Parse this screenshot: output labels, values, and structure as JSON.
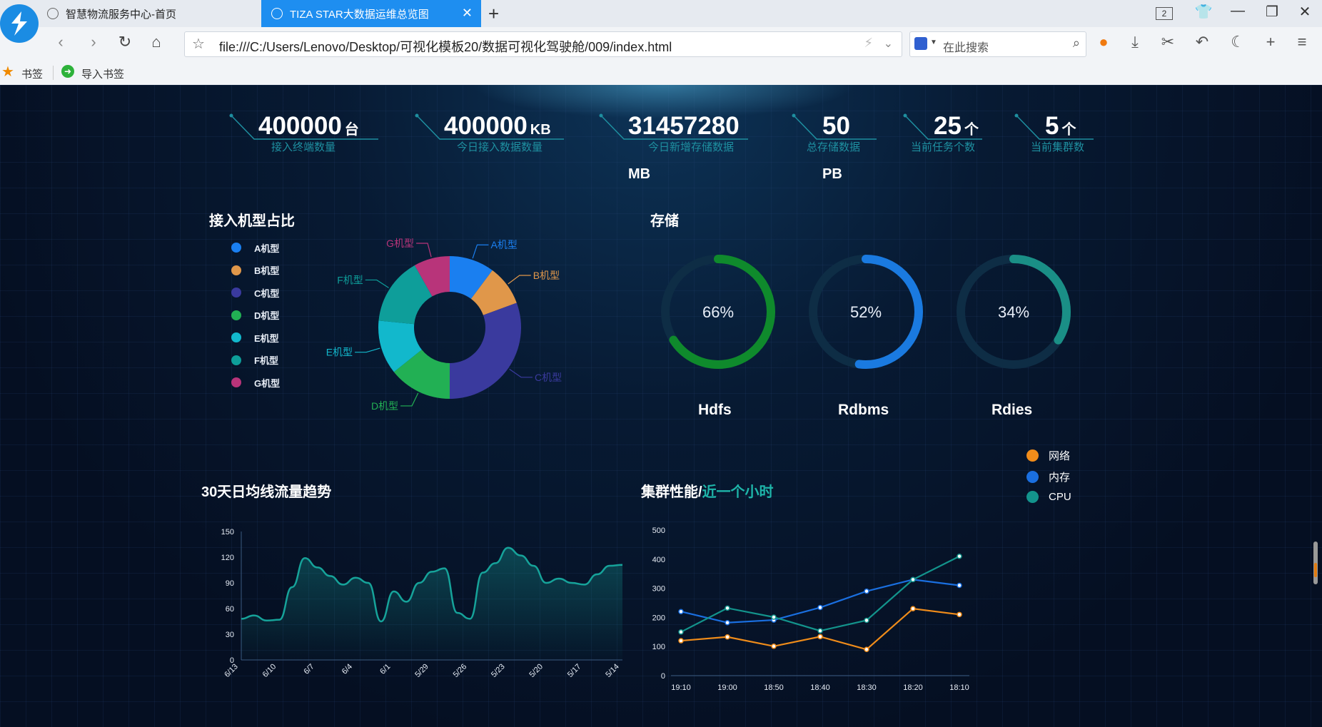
{
  "browser": {
    "tabs": [
      {
        "title": "智慧物流服务中心-首页",
        "active": false
      },
      {
        "title": "TIZA STAR大数据运维总览图",
        "active": true
      }
    ],
    "window_count": "2",
    "url": "file:///C:/Users/Lenovo/Desktop/可视化模板20/数据可视化驾驶舱/009/index.html",
    "search_placeholder": "在此搜索",
    "bookmarks": [
      "书签",
      "导入书签"
    ]
  },
  "kpis": [
    {
      "value": "400000",
      "unit": "台",
      "label": "接入终端数量"
    },
    {
      "value": "400000",
      "unit": "KB",
      "label": "今日接入数据数量"
    },
    {
      "value": "31457280",
      "unit": "MB",
      "label": "今日新增存储数据"
    },
    {
      "value": "50",
      "unit": "PB",
      "label": "总存储数据"
    },
    {
      "value": "25",
      "unit": "个",
      "label": "当前任务个数"
    },
    {
      "value": "5",
      "unit": "个",
      "label": "当前集群数"
    }
  ],
  "pie_section": {
    "title": "接入机型占比"
  },
  "storage_section": {
    "title": "存储"
  },
  "flow_section": {
    "title": "30天日均线流量趋势"
  },
  "cluster_section": {
    "title_main": "集群性能/",
    "title_highlight": "近一个小时"
  },
  "colors": {
    "kpi_line": "#1e8fa0",
    "accent_teal": "#1eb5a9"
  },
  "chart_data": [
    {
      "type": "pie",
      "donut": true,
      "categories": [
        "A机型",
        "B机型",
        "C机型",
        "D机型",
        "E机型",
        "F机型",
        "G机型"
      ],
      "values": [
        10,
        9,
        30,
        14,
        12,
        15,
        8
      ],
      "colors": [
        "#1a7ff0",
        "#e0974a",
        "#3a3a9e",
        "#22b054",
        "#12b8cc",
        "#0e9e9a",
        "#b8347a"
      ],
      "legend": "left"
    },
    {
      "type": "gauge",
      "items": [
        {
          "name": "Hdfs",
          "value": 66,
          "label": "66%",
          "color": "#0f8a2c"
        },
        {
          "name": "Rdbms",
          "value": 52,
          "label": "52%",
          "color": "#1a7ae0"
        },
        {
          "name": "Rdies",
          "value": 34,
          "label": "34%",
          "color": "#1a8f86"
        }
      ]
    },
    {
      "type": "area",
      "x": [
        "6/13",
        "6/12",
        "6/11",
        "6/10",
        "6/9",
        "6/8",
        "6/7",
        "6/6",
        "6/5",
        "6/4",
        "6/3",
        "6/2",
        "6/1",
        "5/31",
        "5/30",
        "5/29",
        "5/28",
        "5/27",
        "5/26",
        "5/25",
        "5/24",
        "5/23",
        "5/22",
        "5/21",
        "5/20",
        "5/19",
        "5/18",
        "5/17",
        "5/16",
        "5/15",
        "5/14"
      ],
      "x_tick_labels": [
        "6/13",
        "6/10",
        "6/7",
        "6/4",
        "6/1",
        "5/29",
        "5/26",
        "5/23",
        "5/20",
        "5/17",
        "5/14"
      ],
      "values": [
        48,
        52,
        46,
        47,
        85,
        119,
        108,
        98,
        88,
        96,
        90,
        45,
        80,
        68,
        90,
        103,
        107,
        55,
        48,
        102,
        113,
        131,
        122,
        110,
        90,
        95,
        90,
        88,
        100,
        110,
        111
      ],
      "ylim": [
        0,
        150
      ],
      "yticks": [
        0,
        30,
        60,
        90,
        120,
        150
      ],
      "color": "#16a39a",
      "grid": false
    },
    {
      "type": "line",
      "categories": [
        "19:10",
        "19:00",
        "18:50",
        "18:40",
        "18:30",
        "18:20",
        "18:10"
      ],
      "series": [
        {
          "name": "网络",
          "values": [
            120,
            133,
            101,
            134,
            90,
            230,
            210
          ],
          "color": "#f08c1a"
        },
        {
          "name": "内存",
          "values": [
            220,
            182,
            191,
            234,
            290,
            330,
            310
          ],
          "color": "#1a6fe0"
        },
        {
          "name": "CPU",
          "values": [
            150,
            232,
            201,
            154,
            190,
            330,
            410
          ],
          "color": "#13948c"
        }
      ],
      "ylim": [
        0,
        500
      ],
      "yticks": [
        0,
        100,
        200,
        300,
        400,
        500
      ],
      "legend": "right",
      "grid": false
    }
  ]
}
